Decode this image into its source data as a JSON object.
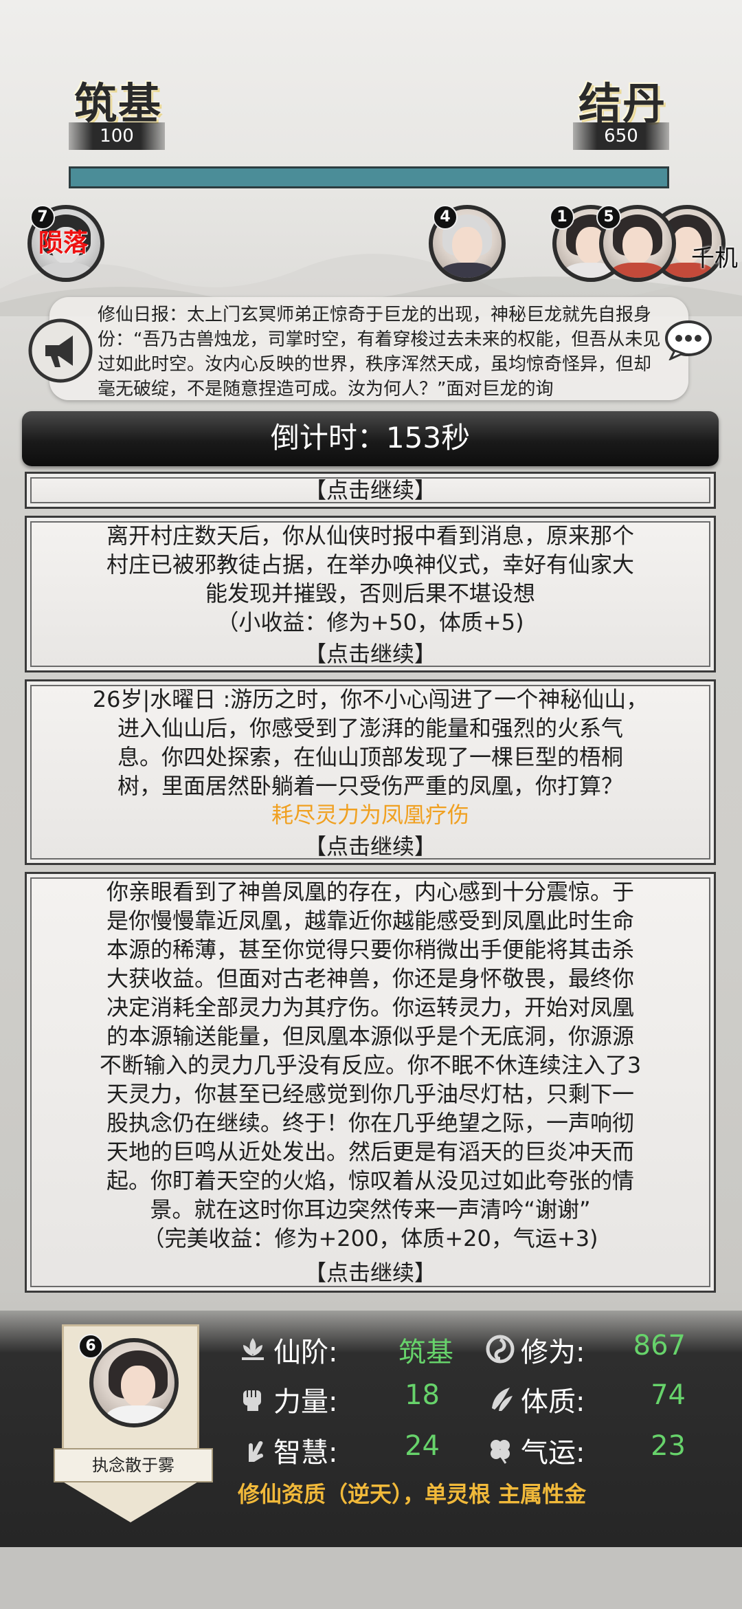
{
  "realm": {
    "current_name": "筑基",
    "current_value": "100",
    "next_name": "结丹",
    "next_value": "650"
  },
  "characters": [
    {
      "badge": "7",
      "status": "陨落",
      "label": ""
    },
    {
      "badge": "4",
      "status": "",
      "label": ""
    },
    {
      "badge": "1",
      "status": "",
      "label": ""
    },
    {
      "badge": "5",
      "status": "",
      "label": ""
    },
    {
      "badge": "",
      "status": "",
      "label": "千机"
    }
  ],
  "news": {
    "text": "修仙日报：太上门玄冥师弟正惊奇于巨龙的出现，神秘巨龙就先自报身份：“吾乃古兽烛龙，司掌时空，有着穿梭过去未来的权能，但吾从未见过如此时空。汝内心反映的世界，秩序浑然天成，虽均惊奇怪异，但却毫无破绽，不是随意捏造可成。汝为何人？”面对巨龙的询"
  },
  "countdown": {
    "text": "倒计时：153秒"
  },
  "events": [
    {
      "lines": [],
      "continue": "【点击继续】"
    },
    {
      "lines": [
        "离开村庄数天后，你从仙侠时报中看到消息，原来那个",
        "村庄已被邪教徒占据，在举办唤神仪式，幸好有仙家大",
        "能发现并摧毁，否则后果不堪设想",
        "（小收益：修为+50，体质+5)"
      ],
      "continue": "【点击继续】"
    },
    {
      "lines": [
        "26岁|水曜日 :游历之时，你不小心闯进了一个神秘仙山，",
        "进入仙山后，你感受到了澎湃的能量和强烈的火系气",
        "息。你四处探索，在仙山顶部发现了一棵巨型的梧桐",
        "树，里面居然卧躺着一只受伤严重的凤凰，你打算？"
      ],
      "choice": "耗尽灵力为凤凰疗伤",
      "continue": "【点击继续】"
    },
    {
      "lines": [
        "你亲眼看到了神兽凤凰的存在，内心感到十分震惊。于",
        "是你慢慢靠近凤凰，越靠近你越能感受到凤凰此时生命",
        "本源的稀薄，甚至你觉得只要你稍微出手便能将其击杀",
        "大获收益。但面对古老神兽，你还是身怀敬畏，最终你",
        "决定消耗全部灵力为其疗伤。你运转灵力，开始对凤凰",
        "的本源输送能量，但凤凰本源似乎是个无底洞，你源源",
        "不断输入的灵力几乎没有反应。你不眠不休连续注入了3",
        "天灵力，你甚至已经感觉到你几乎油尽灯枯，只剩下一",
        "股执念仍在继续。终于！你在几乎绝望之际，一声响彻",
        "天地的巨鸣从近处发出。然后更是有滔天的巨炎冲天而",
        "起。你盯着天空的火焰，惊叹着从没见过如此夸张的情",
        "景。就在这时你耳边突然传来一声清吟“谢谢”",
        "（完美收益：修为+200，体质+20，气运+3)"
      ],
      "continue": "【点击继续】"
    }
  ],
  "player": {
    "badge": "6",
    "title": "执念散于雾",
    "stats": {
      "rank_label": "仙阶:",
      "rank_value": "筑基",
      "cultivation_label": "修为:",
      "cultivation_value": "867",
      "strength_label": "力量:",
      "strength_value": "18",
      "constitution_label": "体质:",
      "constitution_value": "74",
      "wisdom_label": "智慧:",
      "wisdom_value": "24",
      "luck_label": "气运:",
      "luck_value": "23"
    },
    "aptitude": "修仙资质（逆天），单灵根 主属性金"
  },
  "colors": {
    "progress": "#4b8d98",
    "stat_value": "#67d36b",
    "aptitude": "#f1b93a",
    "choice": "#f0a020",
    "fallen": "#ee1111"
  }
}
